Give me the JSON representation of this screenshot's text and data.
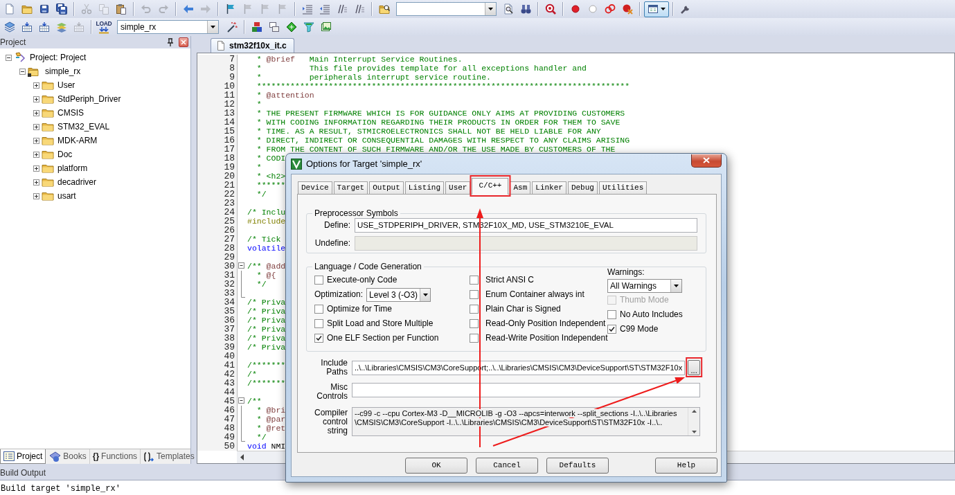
{
  "toolbar": {
    "row_1": [
      {
        "disabled": false
      },
      {
        "disabled": false
      },
      {
        "disabled": false
      },
      {
        "disabled": false
      },
      {
        "disabled": true
      },
      {
        "disabled": true
      },
      {
        "disabled": false
      },
      {
        "disabled": true
      },
      {
        "disabled": true
      },
      {
        "disabled": false
      },
      {
        "disabled": true
      },
      {
        "disabled": false
      },
      {
        "disabled": true
      },
      {
        "disabled": true
      },
      {
        "disabled": true
      },
      {
        "disabled": false
      },
      {
        "disabled": false
      },
      {
        "disabled": false
      },
      {
        "disabled": false
      },
      {
        "disabled": false
      },
      {
        "disabled": false
      },
      {
        "disabled": false
      },
      {
        "disabled": false
      },
      {
        "disabled": false
      },
      {
        "disabled": false
      },
      {
        "disabled": false
      },
      {
        "disabled": false
      },
      {
        "disabled": false
      },
      {
        "disabled": false
      }
    ],
    "row_2": [
      {
        "disabled": false
      },
      {
        "disabled": false
      },
      {
        "disabled": false
      },
      {
        "disabled": false
      },
      {
        "disabled": true
      },
      {
        "disabled": false,
        "caption": "LOAD"
      },
      {
        "disabled": false
      },
      {
        "disabled": false
      },
      {
        "disabled": false
      },
      {
        "disabled": false
      },
      {
        "disabled": false
      },
      {
        "disabled": false
      }
    ],
    "target_select": {
      "value": "simple_rx"
    }
  },
  "project_panel": {
    "title": "Project",
    "tree": [
      {
        "label": "Project: Project",
        "expanded": true,
        "children": [
          {
            "label": "simple_rx",
            "expanded": true,
            "children": [
              {
                "label": "User",
                "expanded": false
              },
              {
                "label": "StdPeriph_Driver",
                "expanded": false
              },
              {
                "label": "CMSIS",
                "expanded": false
              },
              {
                "label": "STM32_EVAL",
                "expanded": false
              },
              {
                "label": "MDK-ARM",
                "expanded": false
              },
              {
                "label": "Doc",
                "expanded": false
              },
              {
                "label": "platform",
                "expanded": false
              },
              {
                "label": "decadriver",
                "expanded": false
              },
              {
                "label": "usart",
                "expanded": false
              }
            ]
          }
        ]
      }
    ],
    "tabs": [
      {
        "label": "Project",
        "selected": true
      },
      {
        "label": "Books",
        "selected": false
      },
      {
        "label": "Functions",
        "selected": false,
        "glyph": "{}"
      },
      {
        "label": "Templates",
        "selected": false
      }
    ]
  },
  "editor": {
    "tabs": [
      {
        "label": "stm32f10x_it.c",
        "selected": true
      }
    ],
    "lines": [
      {
        "number": "7",
        "segments": [
          {
            "kind": "comment",
            "text": "  * "
          },
          {
            "kind": "tag",
            "text": "@brief"
          },
          {
            "kind": "comment",
            "text": "   Main Interrupt Service Routines."
          }
        ]
      },
      {
        "number": "8",
        "segments": [
          {
            "kind": "comment",
            "text": "  *          This file provides template for all exceptions handler and"
          }
        ]
      },
      {
        "number": "9",
        "segments": [
          {
            "kind": "comment",
            "text": "  *          peripherals interrupt service routine."
          }
        ]
      },
      {
        "number": "10",
        "segments": [
          {
            "kind": "comment",
            "text": "  ******************************************************************************"
          }
        ]
      },
      {
        "number": "11",
        "segments": [
          {
            "kind": "comment",
            "text": "  * "
          },
          {
            "kind": "tag",
            "text": "@attention"
          }
        ]
      },
      {
        "number": "12",
        "segments": [
          {
            "kind": "comment",
            "text": "  *"
          }
        ]
      },
      {
        "number": "13",
        "segments": [
          {
            "kind": "comment",
            "text": "  * THE PRESENT FIRMWARE WHICH IS FOR GUIDANCE ONLY AIMS AT PROVIDING CUSTOMERS"
          }
        ]
      },
      {
        "number": "14",
        "segments": [
          {
            "kind": "comment",
            "text": "  * WITH CODING INFORMATION REGARDING THEIR PRODUCTS IN ORDER FOR THEM TO SAVE"
          }
        ]
      },
      {
        "number": "15",
        "segments": [
          {
            "kind": "comment",
            "text": "  * TIME. AS A RESULT, STMICROELECTRONICS SHALL NOT BE HELD LIABLE FOR ANY"
          }
        ]
      },
      {
        "number": "16",
        "segments": [
          {
            "kind": "comment",
            "text": "  * DIRECT, INDIRECT OR CONSEQUENTIAL DAMAGES WITH RESPECT TO ANY CLAIMS ARISING"
          }
        ]
      },
      {
        "number": "17",
        "segments": [
          {
            "kind": "comment",
            "text": "  * FROM THE CONTENT OF SUCH FIRMWARE AND/OR THE USE MADE BY CUSTOMERS OF THE"
          }
        ]
      },
      {
        "number": "18",
        "segments": [
          {
            "kind": "comment",
            "text": "  * CODI"
          }
        ]
      },
      {
        "number": "19",
        "segments": [
          {
            "kind": "comment",
            "text": "  *"
          }
        ]
      },
      {
        "number": "20",
        "segments": [
          {
            "kind": "comment",
            "text": "  * <h2>"
          }
        ]
      },
      {
        "number": "21",
        "segments": [
          {
            "kind": "comment",
            "text": "  ******"
          }
        ]
      },
      {
        "number": "22",
        "segments": [
          {
            "kind": "comment",
            "text": "  */"
          }
        ]
      },
      {
        "number": "23"
      },
      {
        "number": "24",
        "segments": [
          {
            "kind": "comment",
            "text": "/* Inclu"
          }
        ]
      },
      {
        "number": "25",
        "segments": [
          {
            "kind": "directive",
            "text": "#include"
          }
        ]
      },
      {
        "number": "26"
      },
      {
        "number": "27",
        "segments": [
          {
            "kind": "comment",
            "text": "/* Tick"
          }
        ]
      },
      {
        "number": "28",
        "segments": [
          {
            "kind": "keyword",
            "text": "volatile"
          }
        ]
      },
      {
        "number": "29"
      },
      {
        "number": "30",
        "kind": "toggle",
        "segments": [
          {
            "kind": "comment",
            "text": "/** "
          },
          {
            "kind": "tag",
            "text": "@add"
          }
        ]
      },
      {
        "number": "31",
        "kind": "guide",
        "segments": [
          {
            "kind": "comment",
            "text": "  * "
          },
          {
            "kind": "tag",
            "text": "@{"
          }
        ]
      },
      {
        "number": "32",
        "kind": "guide",
        "segments": [
          {
            "kind": "comment",
            "text": "  */"
          }
        ]
      },
      {
        "number": "33",
        "kind": "corner"
      },
      {
        "number": "34",
        "segments": [
          {
            "kind": "comment",
            "text": "/* Priva"
          }
        ]
      },
      {
        "number": "35",
        "segments": [
          {
            "kind": "comment",
            "text": "/* Priva"
          }
        ]
      },
      {
        "number": "36",
        "segments": [
          {
            "kind": "comment",
            "text": "/* Priva"
          }
        ]
      },
      {
        "number": "37",
        "segments": [
          {
            "kind": "comment",
            "text": "/* Priva"
          }
        ]
      },
      {
        "number": "38",
        "segments": [
          {
            "kind": "comment",
            "text": "/* Priva"
          }
        ]
      },
      {
        "number": "39",
        "segments": [
          {
            "kind": "comment",
            "text": "/* Priva"
          }
        ]
      },
      {
        "number": "40"
      },
      {
        "number": "41",
        "segments": [
          {
            "kind": "comment",
            "text": "/*******"
          }
        ]
      },
      {
        "number": "42",
        "segments": [
          {
            "kind": "comment",
            "text": "/*"
          }
        ]
      },
      {
        "number": "43",
        "segments": [
          {
            "kind": "comment",
            "text": "/*******"
          }
        ]
      },
      {
        "number": "44"
      },
      {
        "number": "45",
        "kind": "toggle",
        "segments": [
          {
            "kind": "comment",
            "text": "/**"
          }
        ]
      },
      {
        "number": "46",
        "kind": "guide",
        "segments": [
          {
            "kind": "comment",
            "text": "  * "
          },
          {
            "kind": "tag",
            "text": "@bri"
          }
        ]
      },
      {
        "number": "47",
        "kind": "guide",
        "segments": [
          {
            "kind": "comment",
            "text": "  * "
          },
          {
            "kind": "tag",
            "text": "@par"
          }
        ]
      },
      {
        "number": "48",
        "kind": "guide",
        "segments": [
          {
            "kind": "comment",
            "text": "  * "
          },
          {
            "kind": "tag",
            "text": "@ret"
          }
        ]
      },
      {
        "number": "49",
        "kind": "corner",
        "segments": [
          {
            "kind": "comment",
            "text": "  */"
          }
        ]
      },
      {
        "number": "50",
        "segments": [
          {
            "kind": "keyword",
            "text": "void"
          },
          {
            "kind": "plain",
            "text": " NMI"
          }
        ]
      }
    ]
  },
  "build_output": {
    "title": "Build Output",
    "lines": [
      "Build target 'simple_rx'"
    ]
  },
  "dialog": {
    "title": "Options for Target 'simple_rx'",
    "tabs": [
      {
        "label": "Device",
        "selected": false
      },
      {
        "label": "Target",
        "selected": false
      },
      {
        "label": "Output",
        "selected": false
      },
      {
        "label": "Listing",
        "selected": false
      },
      {
        "label": "User",
        "selected": false
      },
      {
        "label": "C/C++",
        "selected": true
      },
      {
        "label": "Asm",
        "selected": false
      },
      {
        "label": "Linker",
        "selected": false
      },
      {
        "label": "Debug",
        "selected": false
      },
      {
        "label": "Utilities",
        "selected": false
      }
    ],
    "preprocessor": {
      "title": "Preprocessor Symbols",
      "define": {
        "label": "Define:",
        "value": "USE_STDPERIPH_DRIVER, STM32F10X_MD, USE_STM3210E_EVAL"
      },
      "undefine": {
        "label": "Undefine:",
        "disabled": true
      }
    },
    "language": {
      "title": "Language / Code Generation",
      "columns": [
        [
          {
            "kind": "checkbox",
            "label": "Execute-only Code",
            "checked": false,
            "disabled": false
          },
          {
            "kind": "select",
            "label": "Optimization:",
            "value": "Level 3 (-O3)"
          },
          {
            "kind": "checkbox",
            "label": "Optimize for Time",
            "checked": false,
            "disabled": false
          },
          {
            "kind": "checkbox",
            "label": "Split Load and Store Multiple",
            "checked": false,
            "disabled": false
          },
          {
            "kind": "checkbox",
            "label": "One ELF Section per Function",
            "checked": true,
            "disabled": false
          }
        ],
        [
          {
            "kind": "checkbox",
            "label": "Strict ANSI C",
            "checked": false,
            "disabled": false
          },
          {
            "kind": "checkbox",
            "label": "Enum Container always int",
            "checked": false,
            "disabled": false
          },
          {
            "kind": "checkbox",
            "label": "Plain Char is Signed",
            "checked": false,
            "disabled": false
          },
          {
            "kind": "checkbox",
            "label": "Read-Only Position Independent",
            "checked": false,
            "disabled": false
          },
          {
            "kind": "checkbox",
            "label": "Read-Write Position Independent",
            "checked": false,
            "disabled": false
          }
        ],
        [
          {
            "kind": "heading",
            "label": "Warnings:"
          },
          {
            "kind": "select",
            "value": "All Warnings"
          },
          {
            "kind": "checkbox",
            "label": "Thumb Mode",
            "checked": false,
            "disabled": true
          },
          {
            "kind": "checkbox",
            "label": "No Auto Includes",
            "checked": false,
            "disabled": false
          },
          {
            "kind": "checkbox",
            "label": "C99 Mode",
            "checked": true,
            "disabled": false
          }
        ]
      ]
    },
    "include_paths": {
      "label": "Include Paths",
      "value": "..\\..\\Libraries\\CMSIS\\CM3\\CoreSupport;..\\..\\Libraries\\CMSIS\\CM3\\DeviceSupport\\ST\\STM32F10x",
      "browse": "..."
    },
    "misc_controls": {
      "label": "Misc Controls"
    },
    "compiler_string": {
      "label": "Compiler control string",
      "lines": [
        "--c99 -c --cpu Cortex-M3 -D__MICROLIB -g -O3 --apcs=interwork --split_sections -I..\\..\\Libraries",
        "\\CMSIS\\CM3\\CoreSupport -I..\\..\\Libraries\\CMSIS\\CM3\\DeviceSupport\\ST\\STM32F10x -I..\\.."
      ]
    },
    "buttons": [
      {
        "label": "OK"
      },
      {
        "label": "Cancel"
      },
      {
        "label": "Defaults"
      },
      {
        "label": "Help"
      }
    ]
  }
}
